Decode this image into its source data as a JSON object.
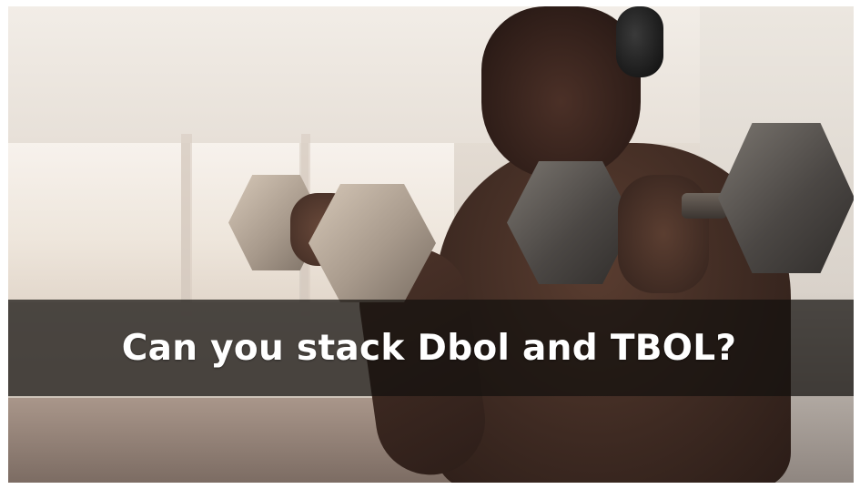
{
  "image": {
    "description_icon": "photo-icon"
  },
  "caption": {
    "text": "Can you stack Dbol and TBOL?"
  },
  "colors": {
    "banner_background": "#14100e",
    "caption_text": "#ffffff"
  }
}
